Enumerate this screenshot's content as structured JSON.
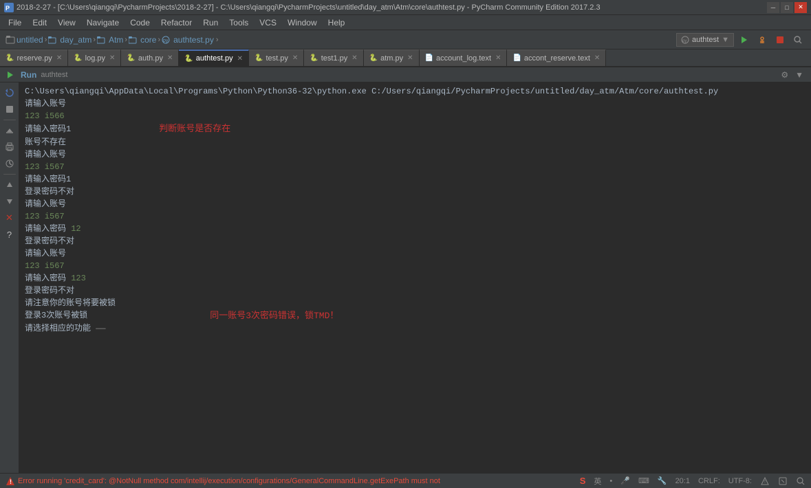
{
  "titlebar": {
    "text": "2018-2-27 - [C:\\Users\\qiangqi\\PycharmProjects\\2018-2-27] - C:\\Users\\qiangqi\\PycharmProjects\\untitled\\day_atm\\Atm\\core\\authtest.py - PyCharm Community Edition 2017.2.3",
    "icon": "PC"
  },
  "menu": {
    "items": [
      "File",
      "Edit",
      "View",
      "Navigate",
      "Code",
      "Refactor",
      "Run",
      "Tools",
      "VCS",
      "Window",
      "Help"
    ]
  },
  "breadcrumb": {
    "items": [
      "untitled",
      "day_atm",
      "Atm",
      "core",
      "authtest.py"
    ],
    "config": "authtest",
    "chevron": "▼"
  },
  "tabs": [
    {
      "label": "reserve.py",
      "active": false,
      "icon": "🐍"
    },
    {
      "label": "log.py",
      "active": false,
      "icon": "🐍"
    },
    {
      "label": "auth.py",
      "active": false,
      "icon": "🐍"
    },
    {
      "label": "authtest.py",
      "active": true,
      "icon": "🐍"
    },
    {
      "label": "test.py",
      "active": false,
      "icon": "🐍"
    },
    {
      "label": "test1.py",
      "active": false,
      "icon": "🐍"
    },
    {
      "label": "atm.py",
      "active": false,
      "icon": "🐍"
    },
    {
      "label": "account_log.text",
      "active": false,
      "icon": "📄"
    },
    {
      "label": "accont_reserve.text",
      "active": false,
      "icon": "📄"
    }
  ],
  "run_panel": {
    "title": "Run",
    "subtitle": "authtest"
  },
  "output": {
    "path_line": "C:\\Users\\qiangqi\\AppData\\Local\\Programs\\Python\\Python36-32\\python.exe C:/Users/qiangqi/PycharmProjects/untitled/day_atm/Atm/core/authtest.py",
    "lines": [
      {
        "text": "请输入账号",
        "type": "normal"
      },
      {
        "text": "123 1566",
        "type": "green"
      },
      {
        "text": "请输入密码1",
        "type": "normal"
      },
      {
        "text": "判断账号是否存在",
        "type": "annotation",
        "offset": 200
      },
      {
        "text": "账号不存在",
        "type": "normal"
      },
      {
        "text": "请输入账号",
        "type": "normal"
      },
      {
        "text": "123 1567",
        "type": "green"
      },
      {
        "text": "请输入密码1",
        "type": "normal"
      },
      {
        "text": "登录密码不对",
        "type": "normal"
      },
      {
        "text": "请输入账号",
        "type": "normal"
      },
      {
        "text": "123 1567",
        "type": "green"
      },
      {
        "text": "请输入密码 12",
        "type": "normal"
      },
      {
        "text": "登录密码不对",
        "type": "normal"
      },
      {
        "text": "请输入账号",
        "type": "normal"
      },
      {
        "text": "123 1567",
        "type": "green"
      },
      {
        "text": "请输入密码 123",
        "type": "normal"
      },
      {
        "text": "登录密码不对",
        "type": "normal"
      },
      {
        "text": "请注意你的账号将要被锁",
        "type": "normal"
      },
      {
        "text": "登录3次账号被锁",
        "type": "normal"
      },
      {
        "text": "同一账号3次密码错误，锁TMD！",
        "type": "annotation2",
        "offset": 270
      },
      {
        "text": "请选择相应的功能 ——",
        "type": "normal"
      }
    ]
  },
  "status_bar": {
    "error_text": "Error running 'credit_card': @NotNull method com/intellij/execution/configurations/GeneralCommandLine.getExePath must not",
    "position": "20:1",
    "line_ending": "CRLF:",
    "encoding": "UTF-8:",
    "icon_warning": "⚠"
  },
  "icons": {
    "run": "▶",
    "stop": "■",
    "debug": "🐛",
    "rerun": "↻",
    "settings": "⚙",
    "search": "🔍",
    "chevron_right": "›",
    "folder": "📁",
    "python_file": "🐍"
  }
}
